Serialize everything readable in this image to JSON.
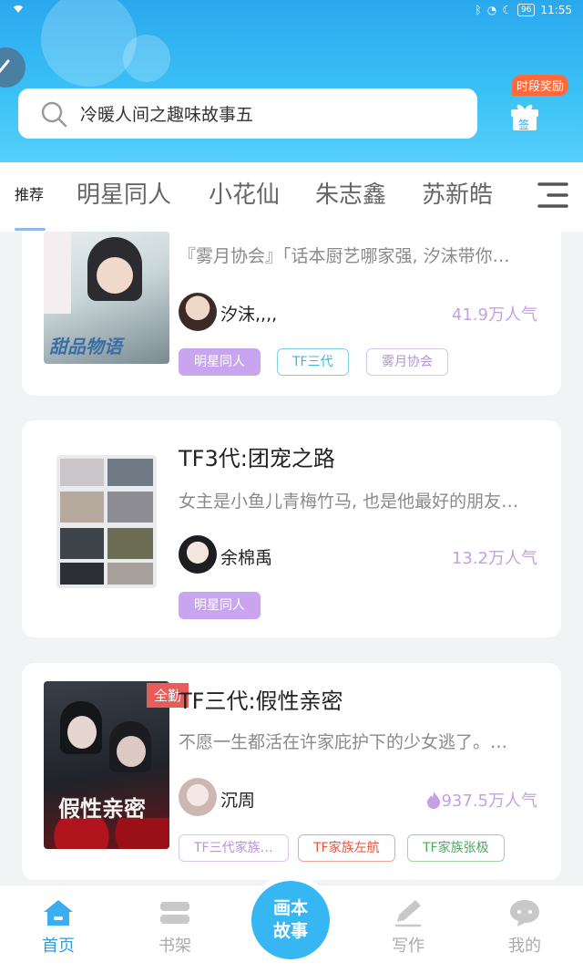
{
  "status_bar": {
    "time": "11:55",
    "battery": "96"
  },
  "search": {
    "placeholder": "冷暖人间之趣味故事五"
  },
  "reward": {
    "badge": "时段奖励",
    "gift_label": "签"
  },
  "tabs": [
    "推荐",
    "明星同人",
    "小花仙",
    "朱志鑫",
    "苏新皓"
  ],
  "cards": [
    {
      "desc": "『雾月协会』「话本厨艺哪家强, 汐沫带你…",
      "author": "汐沫,,,,",
      "popularity": "41.9万人气",
      "tags": [
        "明星同人",
        "TF三代",
        "雾月协会"
      ],
      "cover_text": "甜品物语"
    },
    {
      "title": "TF3代:团宠之路",
      "desc": "女主是小鱼儿青梅竹马, 也是他最好的朋友…",
      "author": "余棉禹",
      "popularity": "13.2万人气",
      "tags": [
        "明星同人"
      ]
    },
    {
      "title": "TF三代:假性亲密",
      "desc": "不愿一生都活在许家庇护下的少女逃了。…",
      "author": "沉周",
      "popularity": "937.5万人气",
      "badge": "全勤",
      "cover_text": "假性亲密",
      "tags": [
        "TF三代家族…",
        "TF家族左航",
        "TF家族张极"
      ]
    }
  ],
  "bottom_nav": {
    "home": "首页",
    "shelf": "书架",
    "center": "画本故事",
    "center_line1": "画本",
    "center_line2": "故事",
    "write": "写作",
    "mine": "我的"
  },
  "colors": {
    "primary": "#36b7f4",
    "popularity": "#c4a0e4",
    "tag_fill": "#c9a5ef",
    "badge_red": "#e85d59"
  }
}
